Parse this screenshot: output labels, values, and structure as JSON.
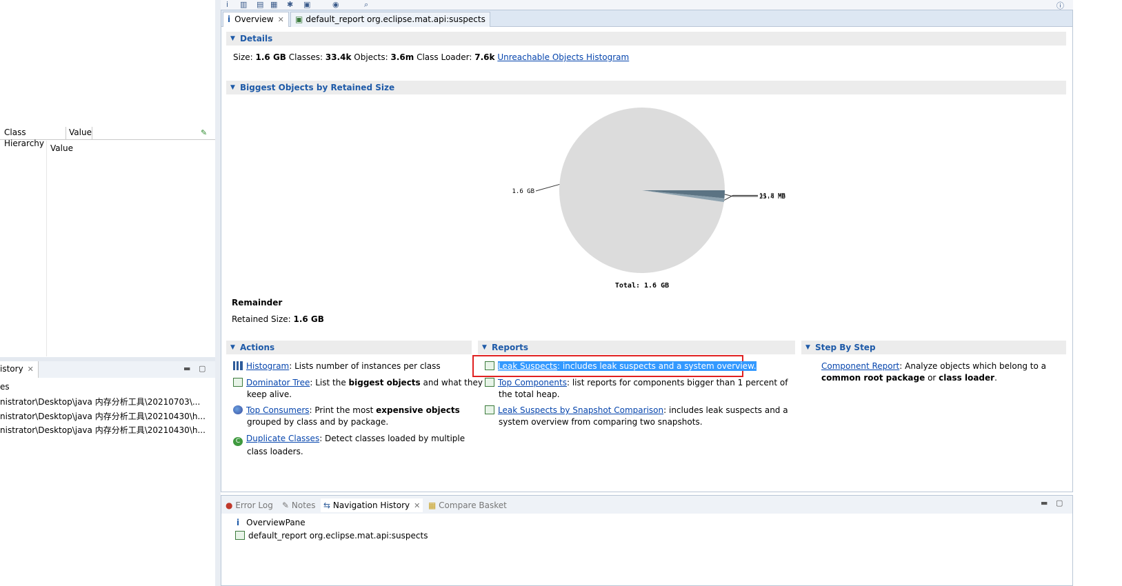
{
  "left_panel": {
    "columns": [
      "Class Hierarchy",
      "Value"
    ],
    "value_label": "Value",
    "history_tab": "istory",
    "history_rows": [
      "es",
      "nistrator\\Desktop\\java 内存分析工具\\20210703\\...",
      "nistrator\\Desktop\\java 内存分析工具\\20210430\\h...",
      "nistrator\\Desktop\\java 内存分析工具\\20210430\\h..."
    ]
  },
  "editor": {
    "tabs": [
      {
        "label": "Overview"
      },
      {
        "label": "default_report  org.eclipse.mat.api:suspects"
      }
    ],
    "details": {
      "title": "Details",
      "size_label": "Size:",
      "size_value": "1.6 GB",
      "classes_label": "Classes:",
      "classes_value": "33.4k",
      "objects_label": "Objects:",
      "objects_value": "3.6m",
      "loader_label": "Class Loader:",
      "loader_value": "7.6k",
      "link": "Unreachable Objects Histogram"
    },
    "biggest": {
      "title": "Biggest Objects by Retained Size",
      "remainder_title": "Remainder",
      "retained_label": "Retained Size:",
      "retained_value": "1.6 GB"
    },
    "actions": {
      "title": "Actions",
      "items": [
        {
          "link": "Histogram",
          "text": ": Lists number of instances per class"
        },
        {
          "link": "Dominator Tree",
          "pre": ": List the ",
          "bold": "biggest objects",
          "post": " and what they",
          "line2": "keep alive."
        },
        {
          "link": "Top Consumers",
          "pre": ": Print the most ",
          "bold": "expensive objects",
          "post": "",
          "line2": "grouped by class and by package."
        },
        {
          "link": "Duplicate Classes",
          "text": ": Detect classes loaded by multiple",
          "line2": "class loaders."
        }
      ]
    },
    "reports": {
      "title": "Reports",
      "items": [
        {
          "link": "Leak Suspects",
          "text": ": includes leak suspects and a system overview."
        },
        {
          "link": "Top Components",
          "text": ": list reports for components bigger than 1 percent of",
          "line2": "the total heap."
        },
        {
          "link": "Leak Suspects by Snapshot Comparison",
          "text": ": includes leak suspects and a",
          "line2": "system overview from comparing two snapshots."
        }
      ]
    },
    "step": {
      "title": "Step By Step",
      "link": "Component Report",
      "text": ": Analyze objects which belong to a",
      "bold1": "common root package",
      "mid": " or ",
      "bold2": "class loader",
      "end": "."
    }
  },
  "bottom_panel": {
    "tabs": [
      "Error Log",
      "Notes",
      "Navigation History",
      "Compare Basket"
    ],
    "rows": [
      "OverviewPane",
      "default_report  org.eclipse.mat.api:suspects"
    ]
  },
  "chart_data": {
    "type": "pie",
    "title": "",
    "total_label": "Total: 1.6 GB",
    "slices": [
      {
        "label": "1.6 GB",
        "value": 1600,
        "color": "#dcdcdc"
      },
      {
        "label": "11.8 MB",
        "value": 11.8,
        "color": "#8ca1ae"
      },
      {
        "label": "25.4 MB",
        "value": 25.4,
        "color": "#5b7383"
      }
    ],
    "units": "MB"
  },
  "colors": {
    "link": "#0645ad",
    "section_title": "#1e5aa8",
    "highlight": "#3399ff",
    "callout_border": "#e02020"
  }
}
